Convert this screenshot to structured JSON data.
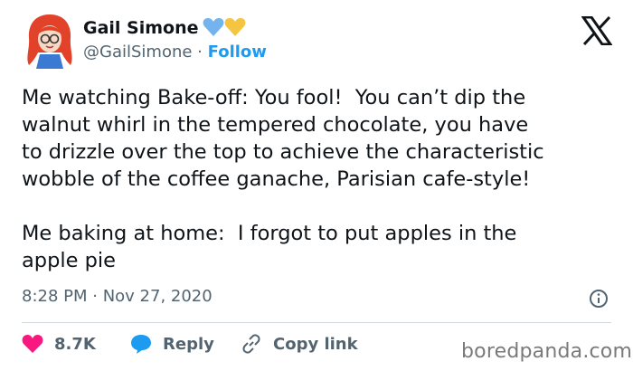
{
  "author": {
    "display_name": "Gail Simone",
    "handle": "@GailSimone",
    "separator": "·",
    "follow_label": "Follow"
  },
  "tweet": {
    "text": "Me watching Bake-off: You fool!  You can’t dip the\nwalnut whirl in the tempered chocolate, you have\nto drizzle over the top to achieve the characteristic\nwobble of the coffee ganache, Parisian cafe-style!\n\nMe baking at home:  I forgot to put apples in the\napple pie",
    "timestamp": "8:28 PM · Nov 27, 2020"
  },
  "actions": {
    "likes": "8.7K",
    "reply_label": "Reply",
    "copy_link_label": "Copy link"
  },
  "watermark": "boredpanda.com",
  "colors": {
    "text": "#0f1419",
    "secondary": "#536471",
    "link": "#1d9bf0",
    "heart": "#f91880",
    "divider": "#cfd9de"
  }
}
